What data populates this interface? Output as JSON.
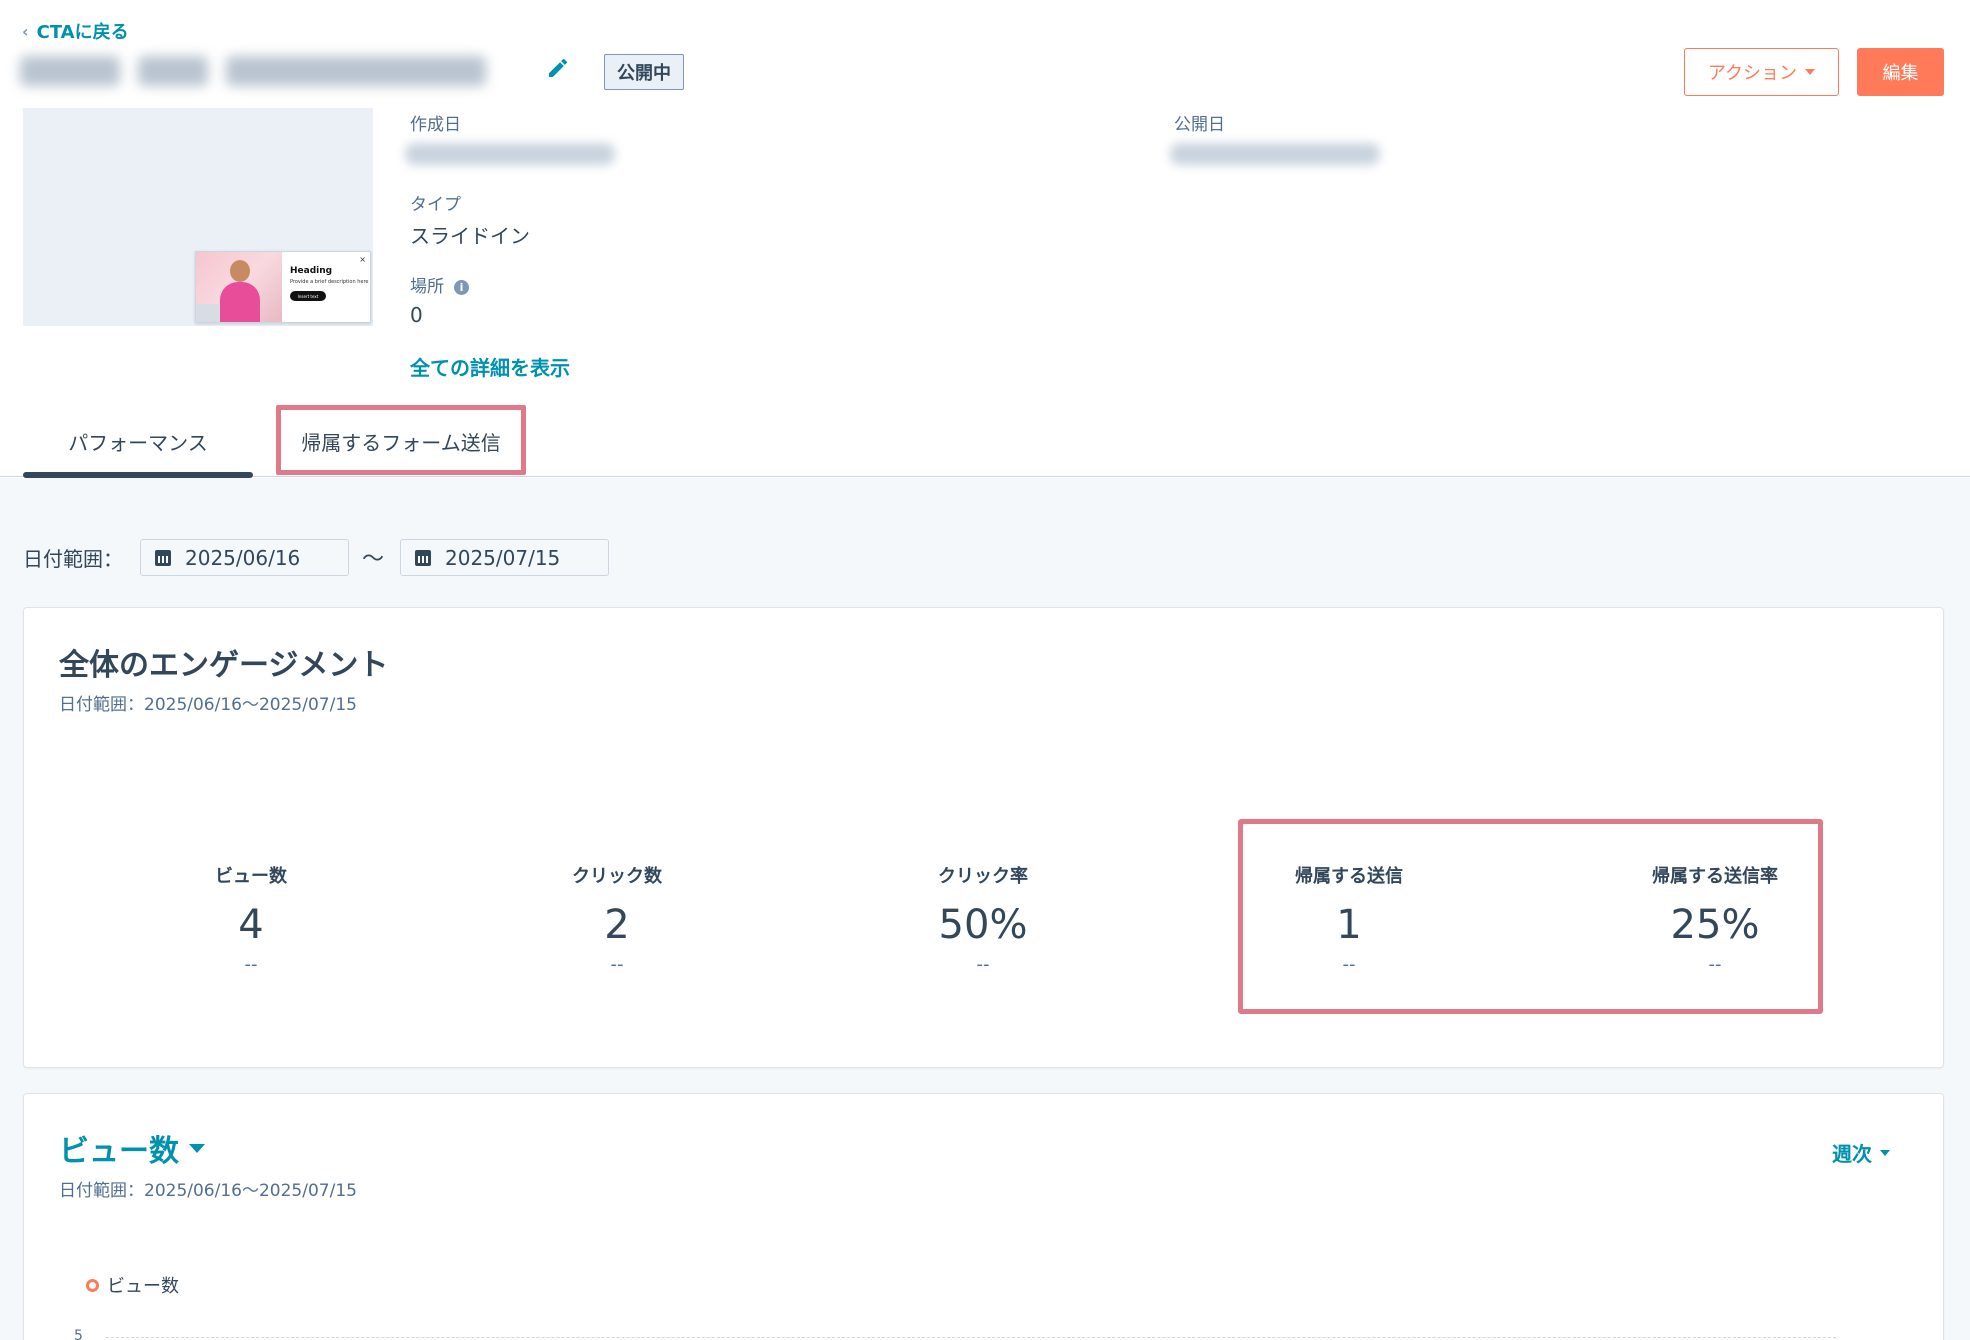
{
  "header": {
    "back_label": "CTAに戻る",
    "status": "公開中",
    "actions_label": "アクション",
    "edit_label": "編集"
  },
  "preview": {
    "heading": "Heading",
    "description": "Provide a brief description here",
    "button": "Insert text"
  },
  "meta": {
    "created_label": "作成日",
    "published_label": "公開日",
    "type_label": "タイプ",
    "type_value": "スライドイン",
    "location_label": "場所",
    "location_value": "0",
    "details_link": "全ての詳細を表示"
  },
  "tabs": [
    {
      "label": "パフォーマンス",
      "active": true
    },
    {
      "label": "帰属するフォーム送信",
      "active": false
    }
  ],
  "date_range": {
    "label": "日付範囲：",
    "start": "2025/06/16",
    "separator": "〜",
    "end": "2025/07/15"
  },
  "engagement": {
    "title": "全体のエンゲージメント",
    "subtitle": "日付範囲：2025/06/16〜2025/07/15",
    "stats": [
      {
        "label": "ビュー数",
        "value": "4",
        "delta": "--"
      },
      {
        "label": "クリック数",
        "value": "2",
        "delta": "--"
      },
      {
        "label": "クリック率",
        "value": "50%",
        "delta": "--"
      },
      {
        "label": "帰属する送信",
        "value": "1",
        "delta": "--"
      },
      {
        "label": "帰属する送信率",
        "value": "25%",
        "delta": "--"
      }
    ]
  },
  "views_chart": {
    "title": "ビュー数",
    "subtitle": "日付範囲：2025/06/16〜2025/07/15",
    "frequency": "週次",
    "legend": "ビュー数",
    "y_tick_top": "5"
  },
  "colors": {
    "accent": "#0091ae",
    "primary_button": "#ff7a59",
    "highlight": "#e07a89",
    "text": "#33475b"
  }
}
